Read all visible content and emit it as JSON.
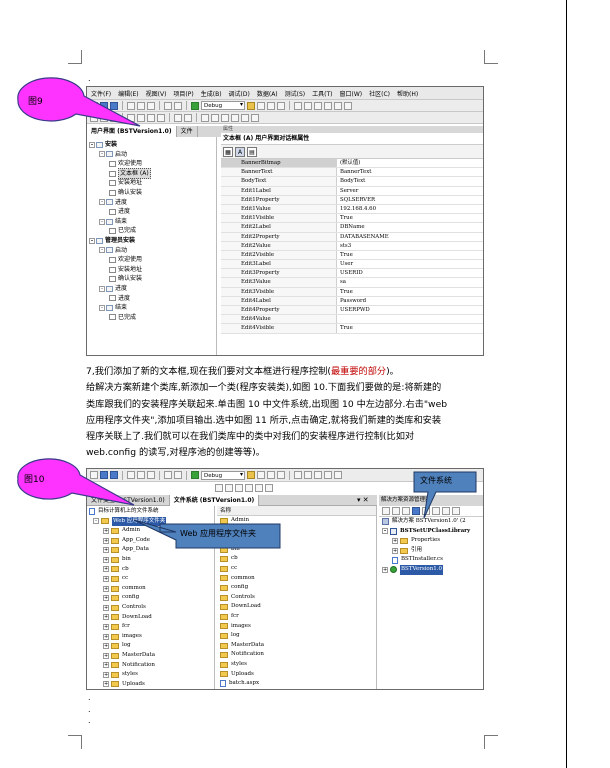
{
  "figure9": {
    "label": "图9",
    "menu": [
      "文件(F)",
      "编辑(E)",
      "视图(V)",
      "项目(P)",
      "生成(B)",
      "调试(D)",
      "数据(A)",
      "测试(S)",
      "工具(T)",
      "窗口(W)",
      "社区(C)",
      "帮助(H)"
    ],
    "config_combo": "Debug",
    "tabs": [
      "用户界面 (BSTVersion1.0)",
      "文件"
    ],
    "tree": [
      {
        "text": "安装",
        "level": 0,
        "bold": true,
        "toggle": "-"
      },
      {
        "text": "启动",
        "level": 1,
        "toggle": "-"
      },
      {
        "text": "欢迎使用",
        "level": 2
      },
      {
        "text": "文本框 (A)",
        "level": 2,
        "selected": true
      },
      {
        "text": "安装地址",
        "level": 2
      },
      {
        "text": "确认安装",
        "level": 2
      },
      {
        "text": "进度",
        "level": 1,
        "toggle": "-"
      },
      {
        "text": "进度",
        "level": 2
      },
      {
        "text": "结束",
        "level": 1,
        "toggle": "-"
      },
      {
        "text": "已完成",
        "level": 2
      },
      {
        "text": "管理员安装",
        "level": 0,
        "bold": true,
        "toggle": "-"
      },
      {
        "text": "启动",
        "level": 1,
        "toggle": "-"
      },
      {
        "text": "欢迎使用",
        "level": 2
      },
      {
        "text": "安装地址",
        "level": 2
      },
      {
        "text": "确认安装",
        "level": 2
      },
      {
        "text": "进度",
        "level": 1,
        "toggle": "-"
      },
      {
        "text": "进度",
        "level": 2
      },
      {
        "text": "结束",
        "level": 1,
        "toggle": "-"
      },
      {
        "text": "已完成",
        "level": 2
      }
    ],
    "properties_title": "属性",
    "properties_header": "文本框 (A) 用户界面对话框属性",
    "properties": [
      {
        "name": "BannerBitmap",
        "value": "(默认值)"
      },
      {
        "name": "BannerText",
        "value": "BannerText"
      },
      {
        "name": "BodyText",
        "value": "BodyText"
      },
      {
        "name": "Edit1Label",
        "value": "Server"
      },
      {
        "name": "Edit1Property",
        "value": "SQLSERVER"
      },
      {
        "name": "Edit1Value",
        "value": "192.168.4.60"
      },
      {
        "name": "Edit1Visible",
        "value": "True"
      },
      {
        "name": "Edit2Label",
        "value": "DBName"
      },
      {
        "name": "Edit2Property",
        "value": "DATABASENAME"
      },
      {
        "name": "Edit2Value",
        "value": "sts3"
      },
      {
        "name": "Edit2Visible",
        "value": "True"
      },
      {
        "name": "Edit3Label",
        "value": "User"
      },
      {
        "name": "Edit3Property",
        "value": "USERID"
      },
      {
        "name": "Edit3Value",
        "value": "sa"
      },
      {
        "name": "Edit3Visible",
        "value": "True"
      },
      {
        "name": "Edit4Label",
        "value": "Password"
      },
      {
        "name": "Edit4Property",
        "value": "USERPWD"
      },
      {
        "name": "Edit4Value",
        "value": ""
      },
      {
        "name": "Edit4Visible",
        "value": "True"
      }
    ]
  },
  "paragraph": {
    "line1_a": "7,我们添加了新的文本框,现在我们要对文本框进行程序控制(",
    "line1_hl": "最重要的部分",
    "line1_b": ")。",
    "line2": "给解决方案新建个类库,新添加一个类(程序安装类),如图 10.下面我们要做的是:将新建的",
    "line3": "类库跟我们的安装程序关联起来.单击图 10 中文件系统,出现图 10 中左边部分.右击\"web",
    "line4": "应用程序文件夹\",添加项目输出.选中如图 11 所示,点击确定,就将我们新建的类库和安装",
    "line5": "程序关联上了.我们就可以在我们类库中的类中对我们的安装程序进行控制(比如对",
    "line6": "web.config 的读写,对程序池的创建等等)。"
  },
  "figure10": {
    "label": "图10",
    "callout_filesystem": "文件系统",
    "callout_webfolder": "Web 应用程序文件夹",
    "config_combo": "Debug",
    "tabs": [
      "文件类型 (BSTVersion1.0)",
      "文件系统 (BSTVersion1.0)"
    ],
    "close_glyph": "▾ ✕",
    "left_tree_root": "目标计算机上的文件系统",
    "left_tree_selected": "Web 应用程序文件夹",
    "left_folders": [
      "Admin",
      "App_Code",
      "App_Data",
      "bin",
      "cb",
      "cc",
      "common",
      "config",
      "Controls",
      "DownLoad",
      "fcr",
      "images",
      "log",
      "MasterData",
      "Notification",
      "styles",
      "Uploads"
    ],
    "right_header": "名称",
    "right_items": [
      {
        "name": "Admin",
        "type": "folder"
      },
      {
        "name": "App_Code",
        "type": "folder"
      },
      {
        "name": "App_Data",
        "type": "folder"
      },
      {
        "name": "bin",
        "type": "folder"
      },
      {
        "name": "cb",
        "type": "folder"
      },
      {
        "name": "cc",
        "type": "folder"
      },
      {
        "name": "common",
        "type": "folder"
      },
      {
        "name": "config",
        "type": "folder"
      },
      {
        "name": "Controls",
        "type": "folder"
      },
      {
        "name": "DownLoad",
        "type": "folder"
      },
      {
        "name": "fcr",
        "type": "folder"
      },
      {
        "name": "images",
        "type": "folder"
      },
      {
        "name": "log",
        "type": "folder"
      },
      {
        "name": "MasterData",
        "type": "folder"
      },
      {
        "name": "Notification",
        "type": "folder"
      },
      {
        "name": "styles",
        "type": "folder"
      },
      {
        "name": "Uploads",
        "type": "folder"
      },
      {
        "name": "batch.aspx",
        "type": "file"
      }
    ],
    "solution_header": "解决方案资源管理器",
    "solution_tree": [
      {
        "text": "解决方案 BSTVersion1.0' (2",
        "kind": "sol",
        "level": 0
      },
      {
        "text": "BSTSetUPClassLibrary",
        "kind": "prj",
        "level": 0,
        "toggle": "-",
        "bold": true
      },
      {
        "text": "Properties",
        "kind": "folder",
        "level": 1,
        "toggle": "+"
      },
      {
        "text": "引用",
        "kind": "folder",
        "level": 1,
        "toggle": "+"
      },
      {
        "text": "BSTInstaller.cs",
        "kind": "file",
        "level": 1
      },
      {
        "text": "BSTVersion1.0",
        "kind": "setup",
        "level": 0,
        "toggle": "+",
        "selected": true
      }
    ]
  },
  "colors": {
    "callout_fill": "#ff33ff",
    "callout_border": "#3a3a8a",
    "box_fill": "#4f81bd",
    "box_border": "#1f3864",
    "highlight": "#c00000"
  }
}
